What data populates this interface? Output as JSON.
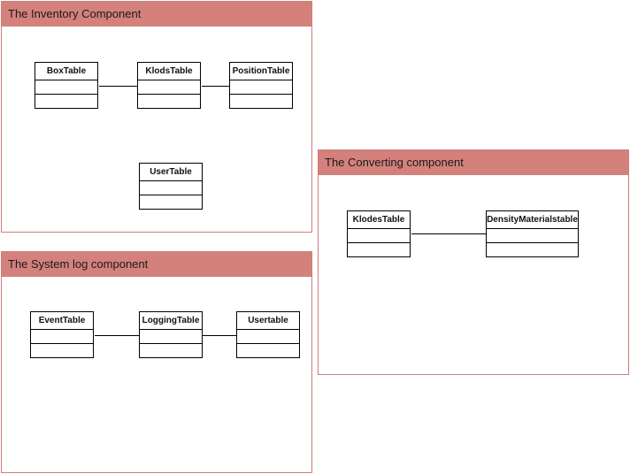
{
  "inventory": {
    "title": "The Inventory Component",
    "tables": [
      "BoxTable",
      "KlodsTable",
      "PositionTable",
      "UserTable"
    ]
  },
  "system_log": {
    "title": "The System log component",
    "tables": [
      "EventTable",
      "LoggingTable",
      "Usertable"
    ]
  },
  "converting": {
    "title": "The Converting component",
    "tables": [
      "KlodesTable",
      "DensityMaterialstable"
    ]
  },
  "colors": {
    "header": "#d4817c",
    "border": "#c9807b"
  }
}
